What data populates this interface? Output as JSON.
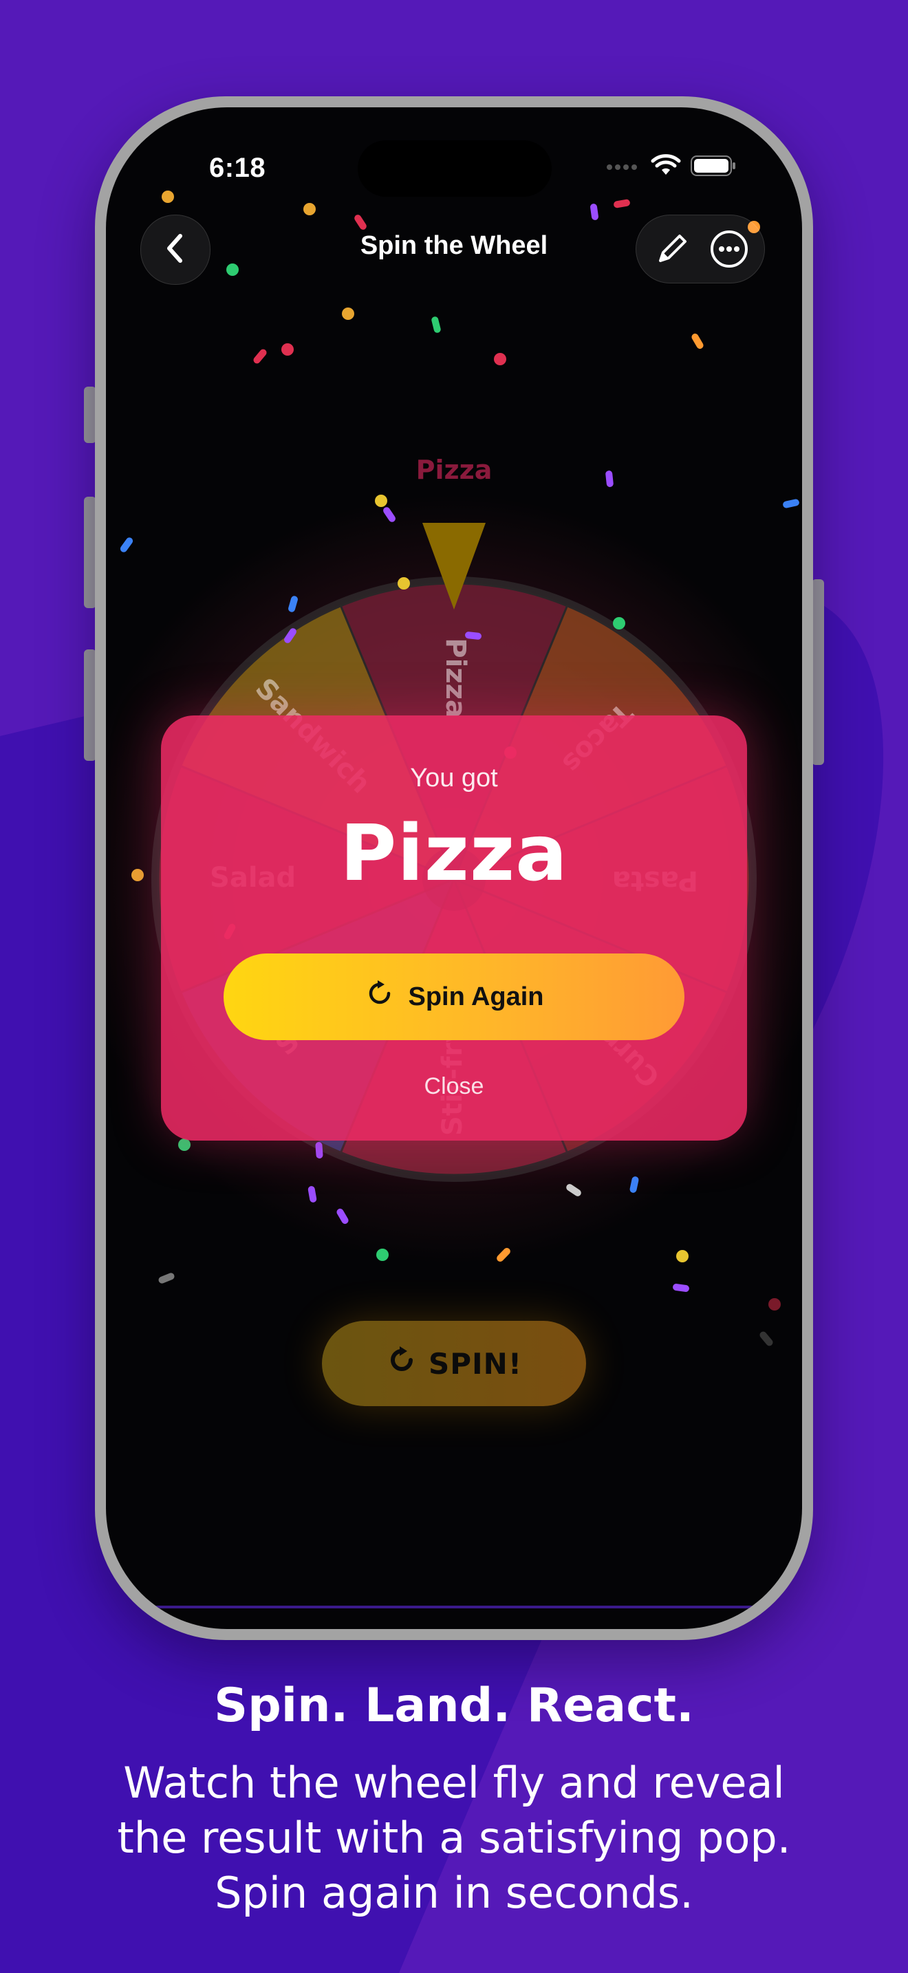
{
  "colors": {
    "background": "#5519b8",
    "accent_yellow": "#ffd611",
    "accent_orange": "#ff9a35",
    "card_pink": "#ec2a64"
  },
  "status_bar": {
    "time": "6:18",
    "icons": [
      "cellular-icon",
      "wifi-icon",
      "battery-icon"
    ]
  },
  "nav": {
    "title": "Spin the Wheel",
    "back_icon": "chevron-left-icon",
    "actions": [
      "pencil-icon",
      "more-icon"
    ]
  },
  "wheel": {
    "indicator_label": "Pizza",
    "segments": [
      {
        "label": "Pizza",
        "color": "#b0103a"
      },
      {
        "label": "Tacos",
        "color": "#e85a10"
      },
      {
        "label": "Pasta",
        "color": "#e0321f"
      },
      {
        "label": "Curry Bowl",
        "color": "#d52a2a"
      },
      {
        "label": "Stir-fry",
        "color": "#e11d48"
      },
      {
        "label": "Sushi",
        "color": "#3b5bd6"
      },
      {
        "label": "Salad",
        "color": "#c4233a"
      },
      {
        "label": "Sandwich",
        "color": "#e0a400"
      }
    ]
  },
  "spin_button": {
    "label": "SPIN!",
    "icon": "refresh-icon"
  },
  "result": {
    "subtitle": "You got",
    "value": "Pizza",
    "spin_again_label": "Spin Again",
    "spin_again_icon": "refresh-icon",
    "close_label": "Close"
  },
  "caption": {
    "title": "Spin. Land. React.",
    "body_lines": [
      "Watch the wheel fly and reveal",
      "the result with a satisfying pop.",
      "Spin again in seconds."
    ]
  }
}
